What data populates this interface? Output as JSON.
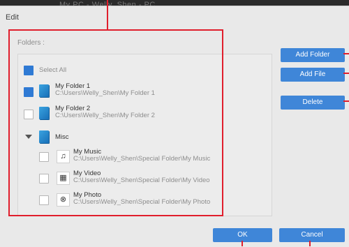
{
  "background": {
    "title": "My PC - Welly_Shen - PC"
  },
  "dialog": {
    "title": "Edit",
    "folders_label": "Folders :",
    "select_all": "Select All",
    "items": [
      {
        "name": "My Folder 1",
        "path": "C:\\Users\\Welly_Shen\\My Folder 1",
        "checked": true
      },
      {
        "name": "My Folder 2",
        "path": "C:\\Users\\Welly_Shen\\My Folder 2",
        "checked": false
      }
    ],
    "misc": {
      "name": "Misc",
      "items": [
        {
          "name": "My Music",
          "path": "C:\\Users\\Welly_Shen\\Special Folder\\My Music",
          "icon": "music-note-icon"
        },
        {
          "name": "My Video",
          "path": "C:\\Users\\Welly_Shen\\Special Folder\\My Video",
          "icon": "film-icon"
        },
        {
          "name": "My Photo",
          "path": "C:\\Users\\Welly_Shen\\Special Folder\\My Photo",
          "icon": "camera-icon"
        }
      ]
    },
    "buttons": {
      "add_folder": "Add Folder",
      "add_file": "Add File",
      "delete": "Delete",
      "ok": "OK",
      "cancel": "Cancel"
    }
  },
  "colors": {
    "accent": "#3f86d8",
    "annotation": "#e01e2c"
  }
}
